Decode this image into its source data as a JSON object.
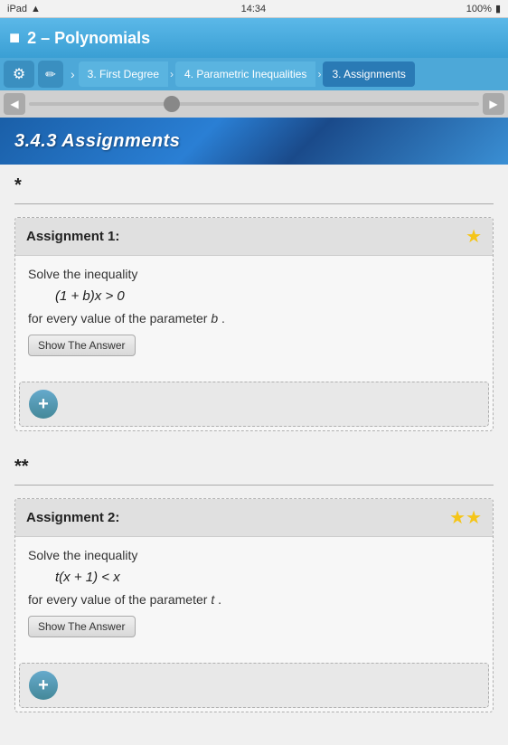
{
  "statusBar": {
    "left": "iPad",
    "wifi": "📶",
    "time": "14:34",
    "battery": "100%"
  },
  "titleBar": {
    "title": "2 – Polynomials"
  },
  "navBar": {
    "breadcrumbs": [
      {
        "label": "3. First Degree",
        "active": false
      },
      {
        "label": "4. Parametric Inequalities",
        "active": false
      },
      {
        "label": "3. Assignments",
        "active": true
      }
    ]
  },
  "sectionHeader": {
    "title": "3.4.3 Assignments"
  },
  "assignments": [
    {
      "id": "assignment-1",
      "title": "Assignment 1:",
      "stars": 1,
      "instruction": "Solve the inequality",
      "formula": "(1 + b)x > 0",
      "paramText": "for every value of the parameter b .",
      "showAnswerLabel": "Show The Answer"
    },
    {
      "id": "assignment-2",
      "title": "Assignment 2:",
      "stars": 2,
      "instruction": "Solve the inequality",
      "formula": "t(x + 1) < x",
      "paramText": "for every value of the parameter t .",
      "showAnswerLabel": "Show The Answer"
    }
  ],
  "difficulty": {
    "section1": "*",
    "section2": "**"
  },
  "icons": {
    "settings": "⚙",
    "pencil": "✏",
    "prev": "◀",
    "next": "▶",
    "add": "+"
  }
}
